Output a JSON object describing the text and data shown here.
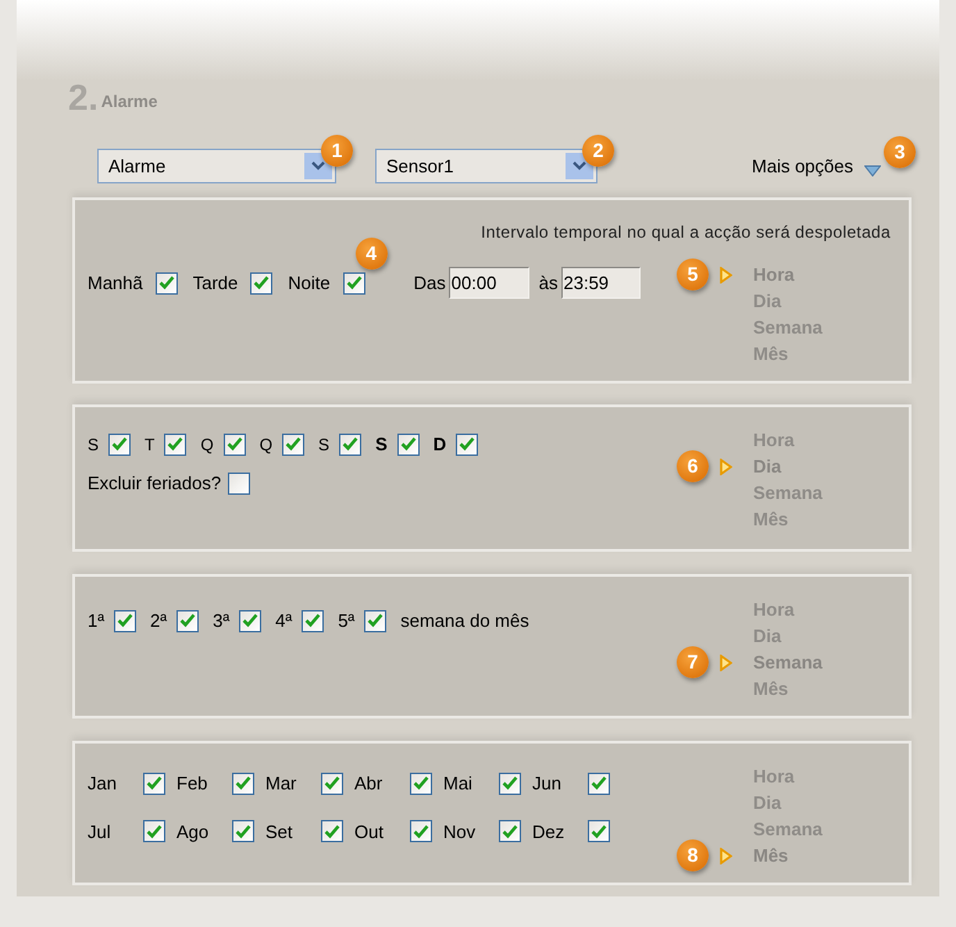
{
  "section": {
    "number": "2.",
    "title": "Alarme"
  },
  "selects": [
    {
      "value": "Alarme",
      "badge": "1"
    },
    {
      "value": "Sensor1",
      "badge": "2"
    }
  ],
  "more_options": {
    "label": "Mais opções",
    "badge": "3"
  },
  "panels": [
    {
      "kind": "time",
      "caption": "Intervalo temporal no qual a acção será despoletada",
      "items": [
        {
          "label": "Manhã",
          "checked": true
        },
        {
          "label": "Tarde",
          "checked": true
        },
        {
          "label": "Noite",
          "checked": true,
          "badge": "4"
        }
      ],
      "from_label": "Das",
      "from": "00:00",
      "to_label": "às",
      "to": "23:59",
      "badge": "5",
      "periods": [
        {
          "label": "Hora",
          "selected": true
        },
        {
          "label": "Dia",
          "selected": false
        },
        {
          "label": "Semana",
          "selected": false
        },
        {
          "label": "Mês",
          "selected": false
        }
      ]
    },
    {
      "kind": "weekdays",
      "items": [
        {
          "label": "S",
          "bold": false,
          "checked": true
        },
        {
          "label": "T",
          "bold": false,
          "checked": true
        },
        {
          "label": "Q",
          "bold": false,
          "checked": true
        },
        {
          "label": "Q",
          "bold": false,
          "checked": true
        },
        {
          "label": "S",
          "bold": false,
          "checked": true
        },
        {
          "label": "S",
          "bold": true,
          "checked": true
        },
        {
          "label": "D",
          "bold": true,
          "checked": true
        }
      ],
      "exclude": {
        "label": "Excluir feriados?",
        "checked": false
      },
      "badge": "6",
      "periods": [
        {
          "label": "Hora",
          "selected": false
        },
        {
          "label": "Dia",
          "selected": true
        },
        {
          "label": "Semana",
          "selected": false
        },
        {
          "label": "Mês",
          "selected": false
        }
      ]
    },
    {
      "kind": "weeks",
      "items": [
        {
          "label": "1ª",
          "checked": true
        },
        {
          "label": "2ª",
          "checked": true
        },
        {
          "label": "3ª",
          "checked": true
        },
        {
          "label": "4ª",
          "checked": true
        },
        {
          "label": "5ª",
          "checked": true
        }
      ],
      "suffix": "semana do mês",
      "badge": "7",
      "periods": [
        {
          "label": "Hora",
          "selected": false
        },
        {
          "label": "Dia",
          "selected": false
        },
        {
          "label": "Semana",
          "selected": true
        },
        {
          "label": "Mês",
          "selected": false
        }
      ]
    },
    {
      "kind": "months",
      "items": [
        {
          "label": "Jan",
          "checked": true
        },
        {
          "label": "Feb",
          "checked": true
        },
        {
          "label": "Mar",
          "checked": true
        },
        {
          "label": "Abr",
          "checked": true
        },
        {
          "label": "Mai",
          "checked": true
        },
        {
          "label": "Jun",
          "checked": true
        },
        {
          "label": "Jul",
          "checked": true
        },
        {
          "label": "Ago",
          "checked": true
        },
        {
          "label": "Set",
          "checked": true
        },
        {
          "label": "Out",
          "checked": true
        },
        {
          "label": "Nov",
          "checked": true
        },
        {
          "label": "Dez",
          "checked": true
        }
      ],
      "badge": "8",
      "periods": [
        {
          "label": "Hora",
          "selected": false
        },
        {
          "label": "Dia",
          "selected": false
        },
        {
          "label": "Semana",
          "selected": false
        },
        {
          "label": "Mês",
          "selected": true
        }
      ]
    }
  ]
}
